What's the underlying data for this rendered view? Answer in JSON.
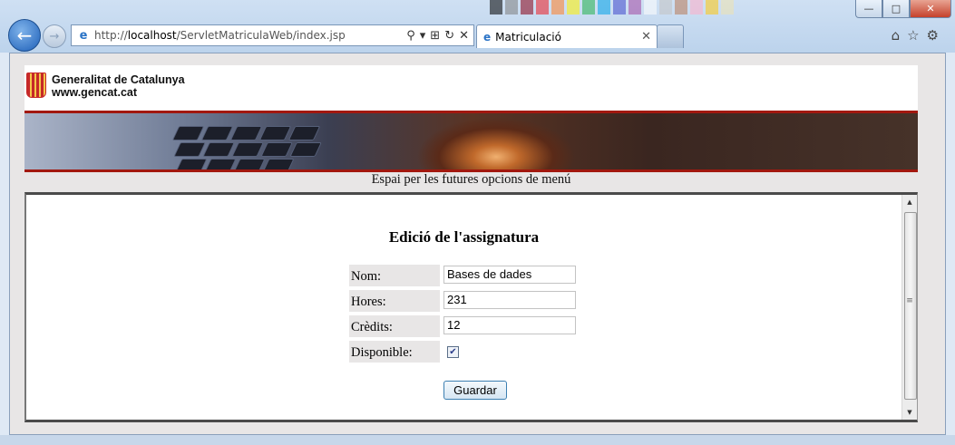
{
  "browser": {
    "address_url": "http://localhost/ServletMatriculaWeb/index.jsp",
    "address_scheme": "http://",
    "address_host": "localhost",
    "address_path": "/ServletMatriculaWeb/index.jsp",
    "tab_title": "Matriculació",
    "window_buttons": {
      "minimize": "—",
      "maximize": "□",
      "close": "✕"
    }
  },
  "header": {
    "org_name": "Generalitat de Catalunya",
    "org_url": "www.gencat.cat"
  },
  "menu": {
    "placeholder_text": "Espai per les futures opcions de menú"
  },
  "form": {
    "title": "Edició de l'assignatura",
    "fields": [
      {
        "label": "Nom:",
        "value": "Bases de dades"
      },
      {
        "label": "Hores:",
        "value": "231"
      },
      {
        "label": "Crèdits:",
        "value": "12"
      }
    ],
    "available_label": "Disponible:",
    "available_checked": true,
    "submit_label": "Guardar"
  },
  "colors": {
    "accent_red": "#a2180f",
    "button_border": "#3c7fb1"
  }
}
